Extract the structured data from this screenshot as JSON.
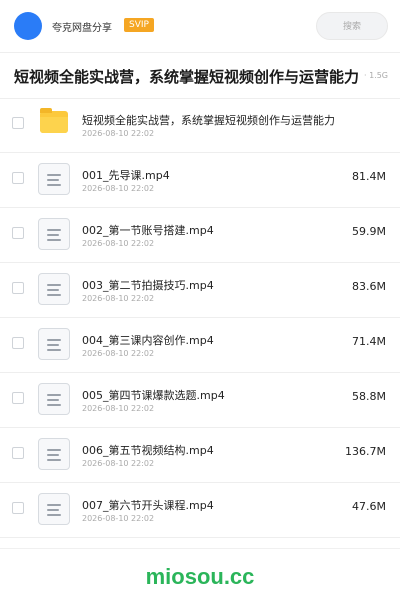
{
  "header": {
    "brand": "夸克网盘分享",
    "badge": "SVIP",
    "search_placeholder": "搜索"
  },
  "share": {
    "title": "短视频全能实战营，系统掌握短视频创作与运营能力",
    "total_size": "· 1.5G"
  },
  "items": [
    {
      "type": "folder",
      "name": "短视频全能实战营，系统掌握短视频创作与运营能力",
      "date": "2026-08-10 22:02",
      "size": ""
    },
    {
      "type": "file",
      "name": "001_先导课.mp4",
      "date": "2026-08-10 22:02",
      "size": "81.4M"
    },
    {
      "type": "file",
      "name": "002_第一节账号搭建.mp4",
      "date": "2026-08-10 22:02",
      "size": "59.9M"
    },
    {
      "type": "file",
      "name": "003_第二节拍摄技巧.mp4",
      "date": "2026-08-10 22:02",
      "size": "83.6M"
    },
    {
      "type": "file",
      "name": "004_第三课内容创作.mp4",
      "date": "2026-08-10 22:02",
      "size": "71.4M"
    },
    {
      "type": "file",
      "name": "005_第四节课爆款选题.mp4",
      "date": "2026-08-10 22:02",
      "size": "58.8M"
    },
    {
      "type": "file",
      "name": "006_第五节视频结构.mp4",
      "date": "2026-08-10 22:02",
      "size": "136.7M"
    },
    {
      "type": "file",
      "name": "007_第六节开头课程.mp4",
      "date": "2026-08-10 22:02",
      "size": "47.6M"
    }
  ],
  "watermark": "miosou.cc",
  "colors": {
    "avatar": "#2a7cf7",
    "badge": "#f5a623",
    "folder": "#fcc93c",
    "watermark": "#2bb55a"
  },
  "icons": {
    "folder": "folder-icon",
    "file": "video-file-icon"
  }
}
